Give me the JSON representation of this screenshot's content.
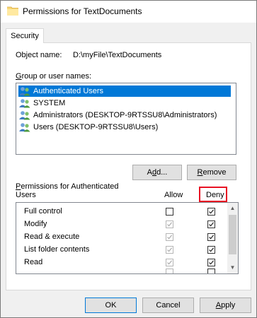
{
  "window": {
    "title": "Permissions for TextDocuments"
  },
  "tabs": [
    {
      "label": "Security",
      "active": true
    }
  ],
  "object": {
    "label": "Object name:",
    "value": "D:\\myFile\\TextDocuments"
  },
  "groups": {
    "label_underlined": "G",
    "label_rest": "roup or user names:",
    "items": [
      {
        "name": "Authenticated Users",
        "selected": true,
        "icon": "users-icon"
      },
      {
        "name": "SYSTEM",
        "selected": false,
        "icon": "users-icon"
      },
      {
        "name": "Administrators (DESKTOP-9RTSSU8\\Administrators)",
        "selected": false,
        "icon": "users-icon"
      },
      {
        "name": "Users (DESKTOP-9RTSSU8\\Users)",
        "selected": false,
        "icon": "users-icon"
      }
    ]
  },
  "buttons": {
    "add_prefix": "A",
    "add_underlined": "d",
    "add_suffix": "d...",
    "remove_underlined": "R",
    "remove_suffix": "emove",
    "ok": "OK",
    "cancel": "Cancel",
    "apply_underlined": "A",
    "apply_suffix": "pply"
  },
  "permissions": {
    "header_line1_underlined": "P",
    "header_line1_rest": "ermissions for Authenticated",
    "header_line2": "Users",
    "allow_label": "Allow",
    "deny_label": "Deny",
    "rows": [
      {
        "name": "Full control",
        "allow": false,
        "allow_disabled": false,
        "deny": true
      },
      {
        "name": "Modify",
        "allow": true,
        "allow_disabled": true,
        "deny": true
      },
      {
        "name": "Read & execute",
        "allow": true,
        "allow_disabled": true,
        "deny": true
      },
      {
        "name": "List folder contents",
        "allow": true,
        "allow_disabled": true,
        "deny": true
      },
      {
        "name": "Read",
        "allow": true,
        "allow_disabled": true,
        "deny": true
      },
      {
        "name": "",
        "allow": true,
        "allow_disabled": true,
        "deny": true
      }
    ]
  },
  "colors": {
    "selection": "#0078d7",
    "highlight_box": "#e81123",
    "window_bg": "#f0f0f0"
  }
}
